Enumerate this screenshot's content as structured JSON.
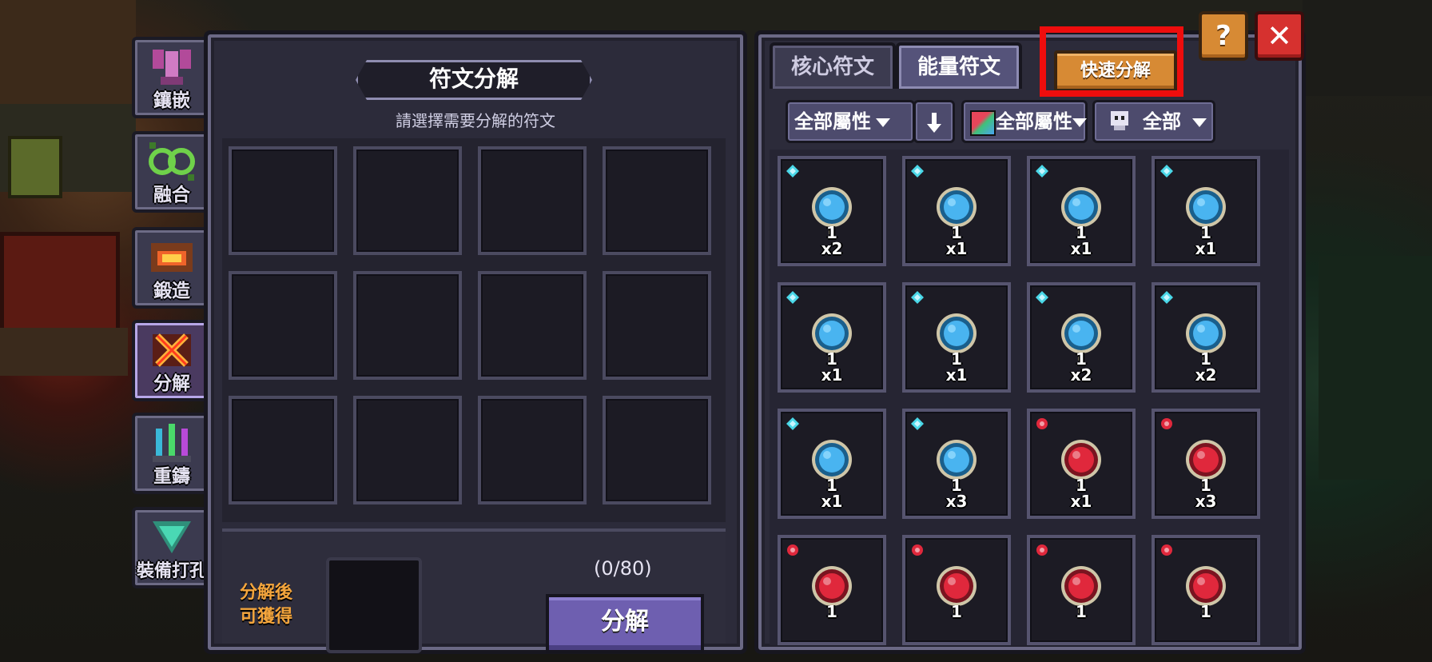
{
  "side_tabs": [
    {
      "label": "鑲嵌",
      "icon": "inlay-icon",
      "active": false
    },
    {
      "label": "融合",
      "icon": "fusion-icon",
      "active": false
    },
    {
      "label": "鍛造",
      "icon": "forge-icon",
      "active": false
    },
    {
      "label": "分解",
      "icon": "decompose-icon",
      "active": true
    },
    {
      "label": "重鑄",
      "icon": "recast-icon",
      "active": false
    },
    {
      "label": "裝備打孔",
      "icon": "socket-icon",
      "active": false
    }
  ],
  "left_panel": {
    "title": "符文分解",
    "subtitle": "請選擇需要分解的符文",
    "yield_label_line1": "分解後",
    "yield_label_line2": "可獲得",
    "count": "(0/80)",
    "decompose_button": "分解"
  },
  "right_panel": {
    "tabs": [
      {
        "label": "核心符文",
        "active": false
      },
      {
        "label": "能量符文",
        "active": true
      }
    ],
    "quick_decompose": "快速分解",
    "filters": {
      "attribute": "全部屬性",
      "sort_icon": "sort-down-arrow-icon",
      "color_attribute": "全部屬性",
      "type": "全部"
    },
    "runes": [
      {
        "element": "water",
        "color": "#49b4f0",
        "level": "1",
        "qty": "x2"
      },
      {
        "element": "water",
        "color": "#49b4f0",
        "level": "1",
        "qty": "x1"
      },
      {
        "element": "water",
        "color": "#49b4f0",
        "level": "1",
        "qty": "x1"
      },
      {
        "element": "water",
        "color": "#49b4f0",
        "level": "1",
        "qty": "x1"
      },
      {
        "element": "water",
        "color": "#49b4f0",
        "level": "1",
        "qty": "x1"
      },
      {
        "element": "water",
        "color": "#49b4f0",
        "level": "1",
        "qty": "x1"
      },
      {
        "element": "water",
        "color": "#49b4f0",
        "level": "1",
        "qty": "x2"
      },
      {
        "element": "water",
        "color": "#49b4f0",
        "level": "1",
        "qty": "x2"
      },
      {
        "element": "water",
        "color": "#49b4f0",
        "level": "1",
        "qty": "x1"
      },
      {
        "element": "water",
        "color": "#49b4f0",
        "level": "1",
        "qty": "x3"
      },
      {
        "element": "fire",
        "color": "#e0283c",
        "level": "1",
        "qty": "x1"
      },
      {
        "element": "fire",
        "color": "#e0283c",
        "level": "1",
        "qty": "x3"
      },
      {
        "element": "fire",
        "color": "#e0283c",
        "level": "1",
        "qty": ""
      },
      {
        "element": "fire",
        "color": "#e0283c",
        "level": "1",
        "qty": ""
      },
      {
        "element": "fire",
        "color": "#e0283c",
        "level": "1",
        "qty": ""
      },
      {
        "element": "fire",
        "color": "#e0283c",
        "level": "1",
        "qty": ""
      }
    ]
  },
  "buttons": {
    "help": "?",
    "close": "✕"
  },
  "colors": {
    "highlight": "#ee0d0d",
    "accent_orange": "#d78a34",
    "button_purple": "#6e5fb0",
    "yield_text": "#f4a53c"
  }
}
